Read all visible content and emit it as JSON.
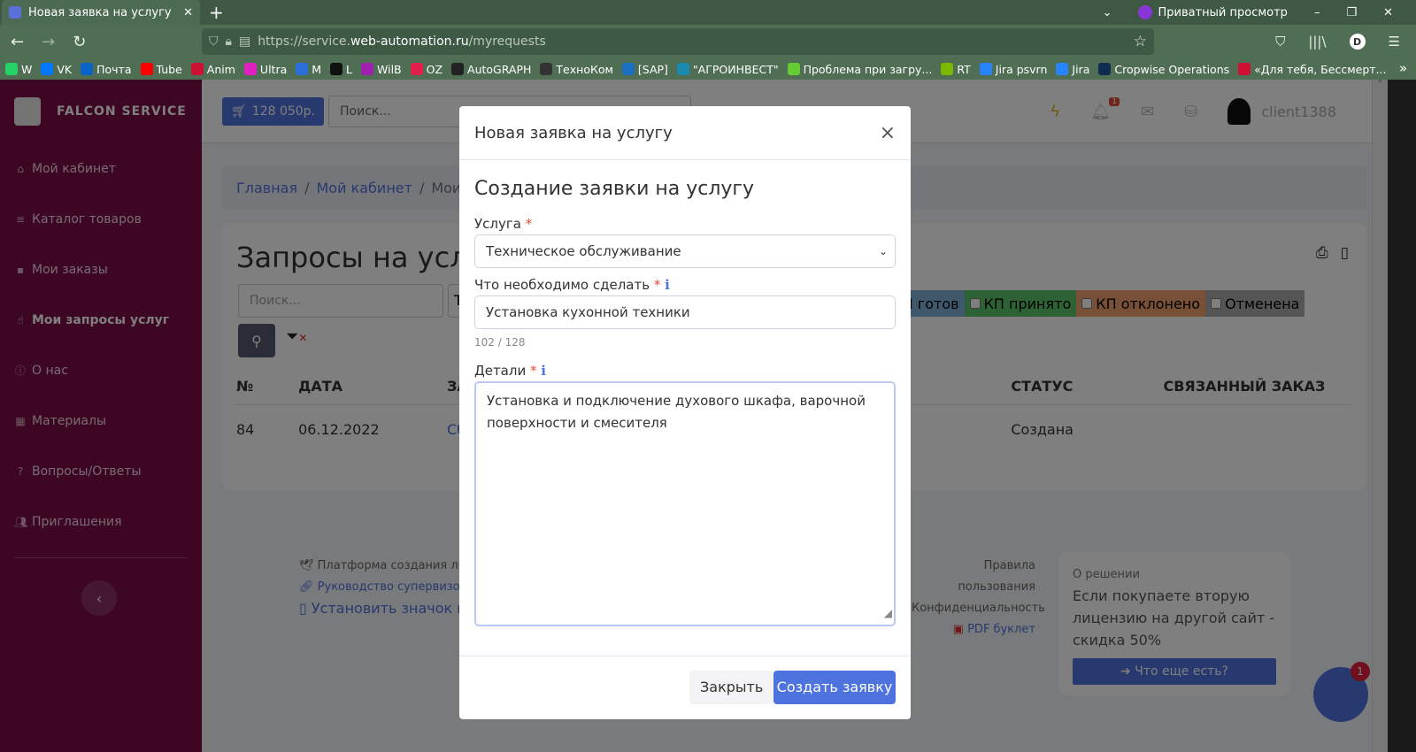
{
  "browser": {
    "tab_title": "Новая заявка на услугу",
    "private_label": "Приватный просмотр",
    "url_prefix": "https://service.",
    "url_domain": "web-automation.ru",
    "url_path": "/myrequests",
    "profile": "D",
    "bookmarks": [
      {
        "label": "W",
        "color": "#25d366"
      },
      {
        "label": "VK",
        "color": "#0077ff"
      },
      {
        "label": "Почта",
        "color": "#0a64c8"
      },
      {
        "label": "Tube",
        "color": "#ff0000"
      },
      {
        "label": "Anim",
        "color": "#cc1133"
      },
      {
        "label": "Ultra",
        "color": "#e020c0"
      },
      {
        "label": "M",
        "color": "#2a6fdb"
      },
      {
        "label": "L",
        "color": "#111111"
      },
      {
        "label": "WilB",
        "color": "#a020b0"
      },
      {
        "label": "OZ",
        "color": "#e0204a"
      },
      {
        "label": "AutoGRAPH",
        "color": "#222222"
      },
      {
        "label": "ТехноКом",
        "color": "#333333"
      },
      {
        "label": "[SAP]",
        "color": "#1a6fc0"
      },
      {
        "label": "\"АГРОИНВЕСТ\"",
        "color": "#1a8ab0"
      },
      {
        "label": "Проблема при загру...",
        "color": "#6c3"
      },
      {
        "label": "RT",
        "color": "#7ab800"
      },
      {
        "label": "Jira psvrn",
        "color": "#2684ff"
      },
      {
        "label": "Jira",
        "color": "#2684ff"
      },
      {
        "label": "Cropwise Operations",
        "color": "#102a50"
      },
      {
        "label": "«Для тебя, Бессмерт...",
        "color": "#d01030"
      }
    ]
  },
  "sidebar": {
    "brand": "FALCON SERVICE",
    "items": [
      {
        "label": "Мой кабинет",
        "icon": "home-icon"
      },
      {
        "label": "Каталог товаров",
        "icon": "list-icon"
      },
      {
        "label": "Мои заказы",
        "icon": "cart-icon"
      },
      {
        "label": "Мои запросы услуг",
        "icon": "hand-icon",
        "active": true
      },
      {
        "label": "О нас",
        "icon": "info-icon"
      },
      {
        "label": "Материалы",
        "icon": "boxes-icon"
      },
      {
        "label": "Вопросы/Ответы",
        "icon": "question-icon"
      },
      {
        "label": "Приглашения",
        "icon": "users-icon"
      }
    ]
  },
  "header": {
    "balance": "128 050р.",
    "search_placeholder": "Поиск...",
    "notifications": "1",
    "username": "client1388"
  },
  "breadcrumb": {
    "home": "Главная",
    "cabinet": "Мой кабинет",
    "current": "Мои"
  },
  "page": {
    "title": "Запросы на услу",
    "search_placeholder": "Поиск...",
    "type_select": "Т",
    "status_filters": [
      {
        "label": "I готов",
        "color": "#7fb0d8"
      },
      {
        "label": "КП принято",
        "color": "#5bc56b"
      },
      {
        "label": "КП отклонено",
        "color": "#f0a070"
      },
      {
        "label": "Отменена",
        "color": "#aaaaaa"
      }
    ],
    "columns": [
      "№",
      "ДАТА",
      "ЗА",
      "СТАТУС",
      "СВЯЗАННЫЙ ЗАКАЗ"
    ],
    "rows": [
      {
        "num": "84",
        "date": "06.12.2022",
        "name": "Сб",
        "status": "Создана",
        "order": ""
      }
    ]
  },
  "footer": {
    "platform": "Платформа создания личн",
    "supervisor": "Руководство супервизора",
    "install": "Установить значок на",
    "terms": "Правила пользования",
    "privacy": "Конфиденциальность",
    "pdf": "PDF буклет"
  },
  "promo": {
    "title": "О решении",
    "text": "Если покупаете вторую лицензию на другой сайт - скидка 50%",
    "button": "➔ Что еще есть?"
  },
  "chat": {
    "badge": "1"
  },
  "modal": {
    "title": "Новая заявка на услугу",
    "heading": "Создание заявки на услугу",
    "service_label": "Услуга",
    "service_value": "Техническое обслуживание",
    "todo_label": "Что необходимо сделать",
    "todo_value": "Установка кухонной техники",
    "counter": "102 / 128",
    "details_label": "Детали",
    "details_value": "Установка и подключение духового шкафа, варочной поверхности и смесителя",
    "close_button": "Закрыть",
    "create_button": "Создать заявку"
  }
}
